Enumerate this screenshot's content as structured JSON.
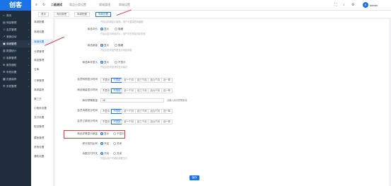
{
  "header": {
    "logo": "创客",
    "nav": [
      "二级测试",
      "商品分类设置",
      "商城管理",
      "商城设置"
    ],
    "username": "admin"
  },
  "sidebar": [
    {
      "icon": "⌂",
      "label": "首页"
    },
    {
      "icon": "▤",
      "label": "商品管理"
    },
    {
      "icon": "☺",
      "label": "会员管理"
    },
    {
      "icon": "↗",
      "label": "营销活动"
    },
    {
      "icon": "▣",
      "label": "商城管理"
    },
    {
      "icon": "▥",
      "label": "数据统计"
    },
    {
      "icon": "◎",
      "label": "客服管理"
    },
    {
      "icon": "✉",
      "label": "服务通知"
    },
    {
      "icon": "⚙",
      "label": "系统设置"
    },
    {
      "icon": "▦",
      "label": "页面装修"
    },
    {
      "icon": "⚙",
      "label": "系统管理"
    }
  ],
  "subsidebar": [
    "商城配置",
    "商城设置",
    "商城设置",
    "分类管理",
    "商品管理",
    "仓库",
    "订单管理",
    "商城装修",
    "第三方",
    "小程序设置",
    "支付设置",
    "配送管理",
    "模板管理",
    "其他设置",
    "通知设置"
  ],
  "tabs": [
    "首页",
    "商品管理",
    "商城配置",
    "商城设置"
  ],
  "form": {
    "hint1": "开启后商城显示客服，用户可直接咨询客服",
    "shop_display_label": "商品评价",
    "show": "显示",
    "hide": "隐藏",
    "hint2": "开启后显示商品评价，用户可在商品详情查看",
    "shop_sale_label": "商品销量",
    "hint3": "开启后在商品列表显示商品销量",
    "stock_label": "商品库存显示",
    "no_show": "不显示",
    "hint4": "开启后在商品详情显示库存",
    "period_label1": "会员购物显示时间",
    "period_label2": "商品销量显示时间",
    "qty_label": "库存预警数量",
    "qty_value": "10",
    "qty_hint": "请输入库存预警数量",
    "period_label3": "会员消费统计时间",
    "period_label4": "会员订单统计时间",
    "period_opts": [
      "不显示",
      "不限制",
      "近一个月",
      "近三个月",
      "近六个月",
      "近一年"
    ],
    "highlight_label": "商品详情显示销量",
    "show2": "显示",
    "no_show2": "不显示",
    "credit_label": "积分抵扣比例",
    "credit_on": "开启",
    "credit_off": "关闭",
    "pay_label": "余额支付开关",
    "pay_opt1": "开启",
    "pay_opt2": "关闭",
    "pay_hint": "开启后用户可使用余额支付",
    "submit": "保存"
  }
}
